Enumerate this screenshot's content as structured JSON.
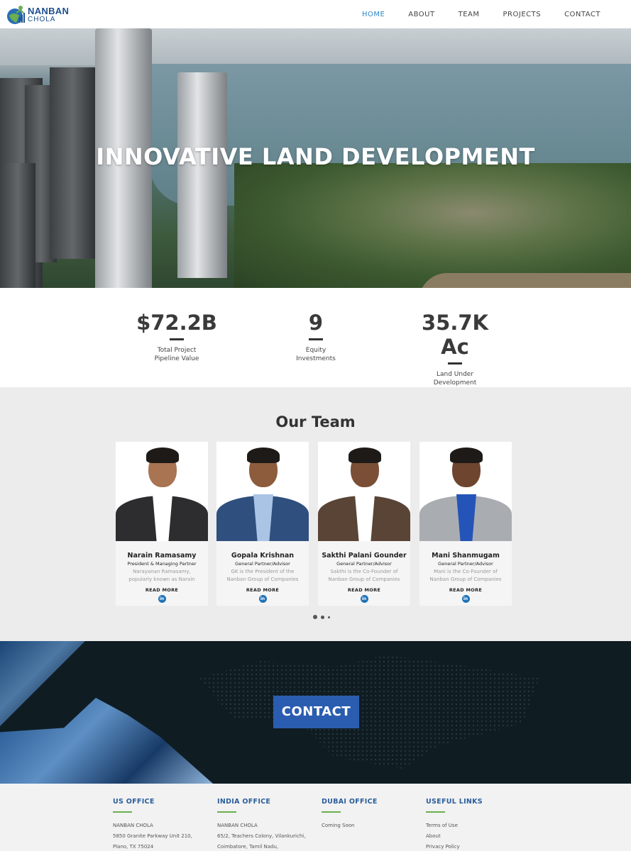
{
  "header": {
    "logo_top": "NANBAN",
    "logo_bottom": "CHOLA",
    "nav": [
      "HOME",
      "ABOUT",
      "TEAM",
      "PROJECTS",
      "CONTACT"
    ]
  },
  "hero": {
    "title": "INNOVATIVE LAND DEVELOPMENT"
  },
  "stats": [
    {
      "value": "$72.2B",
      "label_1": "Total Project",
      "label_2": "Pipeline Value"
    },
    {
      "value": "9",
      "label_1": "Equity",
      "label_2": "Investments"
    },
    {
      "value": "35.7K Ac",
      "label_1": "Land Under",
      "label_2": "Development"
    }
  ],
  "team": {
    "heading": "Our Team",
    "read_more": "READ MORE",
    "linkedin": "in",
    "members": [
      {
        "name": "Narain Ramasamy",
        "role": "President & Managing Partner",
        "bio_1": "Narayanan Ramasamy,",
        "bio_2": "popularly known as Narain"
      },
      {
        "name": "Gopala Krishnan",
        "role": "General Partner/Advisor",
        "bio_1": "GK is the President of the",
        "bio_2": "Nanban Group of Companies"
      },
      {
        "name": "Sakthi Palani Gounder",
        "role": "General Partner/Advisor",
        "bio_1": "Sakthi is the Co-Founder of",
        "bio_2": "Nanban Group of Companies"
      },
      {
        "name": "Mani Shanmugam",
        "role": "General Partner/Advisor",
        "bio_1": "Mani is the Co-Founder of",
        "bio_2": "Nanban Group of Companies"
      }
    ]
  },
  "contact": {
    "button": "CONTACT"
  },
  "footer": {
    "us": {
      "title": "US OFFICE",
      "lines": [
        "NANBAN CHOLA",
        "5850 Granite Parkway Unit 210,",
        "Plano, TX 75024"
      ]
    },
    "india": {
      "title": "INDIA OFFICE",
      "lines": [
        "NANBAN CHOLA",
        "65/2, Teachers Colony, Vilankurichi,",
        "Coimbatore, Tamil Nadu,"
      ]
    },
    "dubai": {
      "title": "DUBAI OFFICE",
      "lines": [
        "Coming Soon"
      ]
    },
    "links": {
      "title": "USEFUL LINKS",
      "lines": [
        "Terms of Use",
        "About",
        "Privacy Policy"
      ]
    }
  },
  "colors": {
    "nav_active": "#2f84c7",
    "contact_button": "#2a5db0",
    "footer_heading": "#2a5d9c",
    "footer_underline": "#6ab04c",
    "linkedin": "#1f73b7"
  }
}
